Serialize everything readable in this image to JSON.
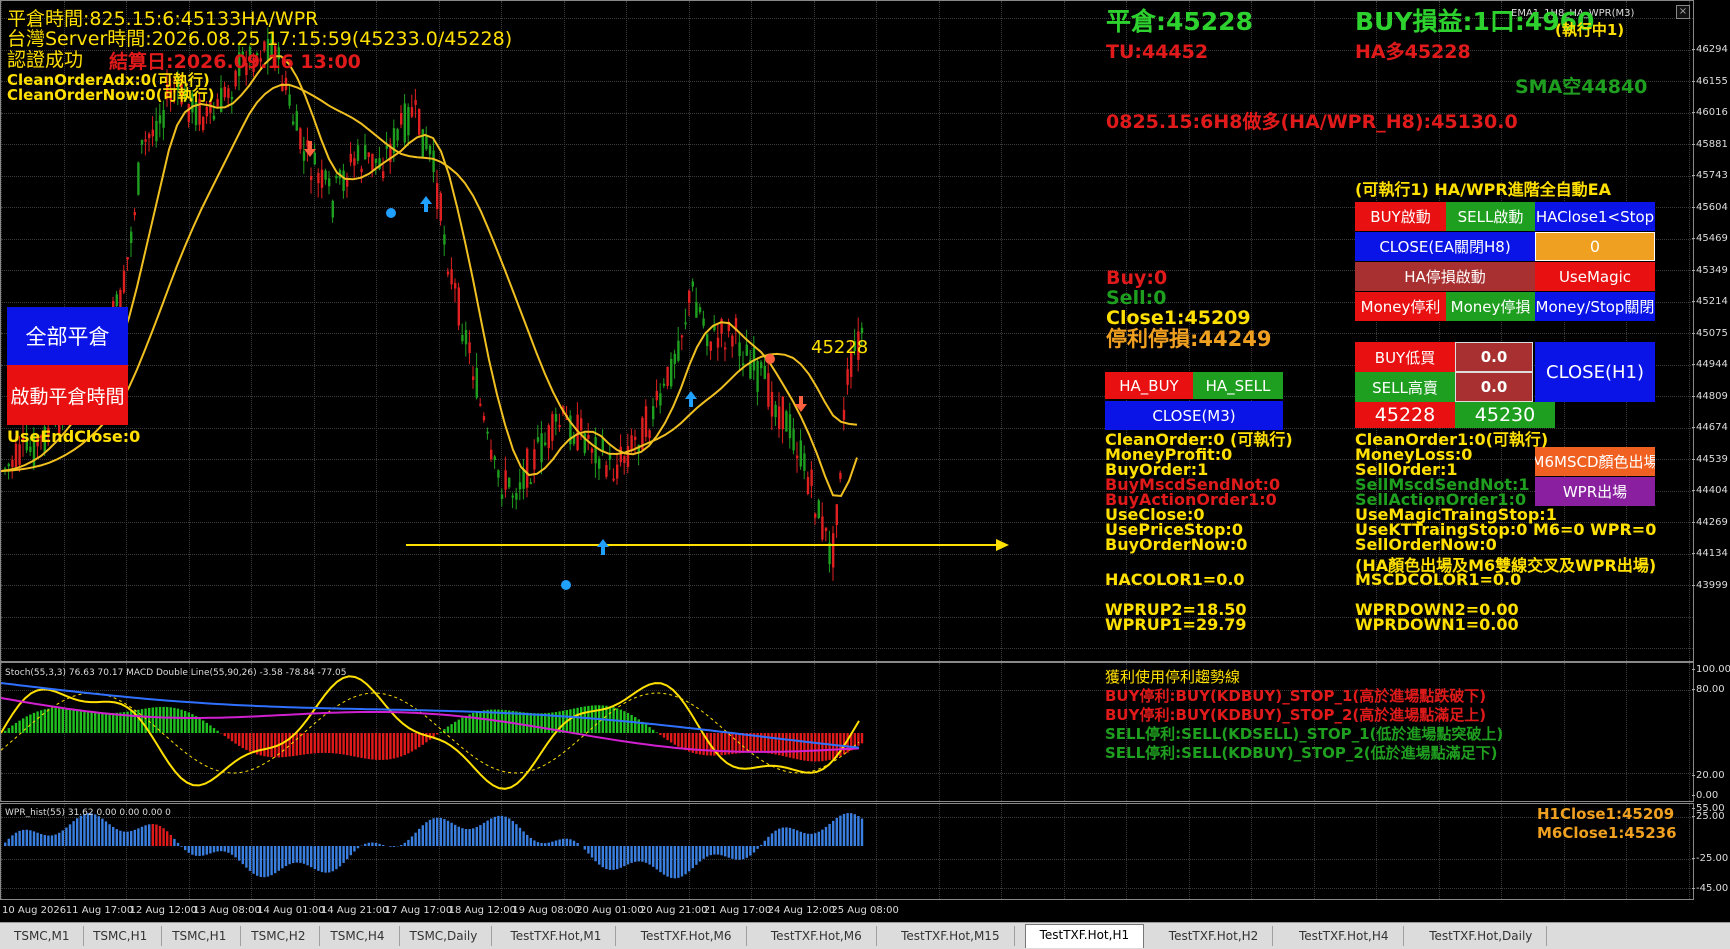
{
  "colors": {
    "bull": "#e02020",
    "bear": "#1f9f1f",
    "grid": "#3c3c3c",
    "ema": "#f0c020",
    "yellow": "#ffe000",
    "macd_line": "#d020d0",
    "signal_line": "#3070ff"
  },
  "info_left": {
    "line1": "平倉時間:825.15:6:45133HA/WPR",
    "line2": "台灣Server時間:2026.08.25 17:15:59(45233.0/45228)",
    "line3": "認證成功",
    "expiry": "結算日:2026.09.16 13:00",
    "clean_adx": "CleanOrderAdx:0(可執行)",
    "clean_now": "CleanOrderNow:0(可執行)"
  },
  "left_buttons": {
    "close_all": "全部平倉",
    "start_time": "啟動平倉時間",
    "use_end_close": "UseEndClose:0"
  },
  "chart_label_price": "45228",
  "header_stats": {
    "close_price": "平倉:45228",
    "pnl": "BUY損益:1口:4960",
    "running": "(執行中1)",
    "tu": "TU:44452",
    "ha_long": "HA多45228",
    "sma": "SMA空44840",
    "signal": "0825.15:6H8做多(HA/WPR_H8):45130.0",
    "top_right_label": "EMA1_1H8_HA_WPR(M3)"
  },
  "mid_stats": {
    "buy": "Buy:0",
    "sell": "Sell:0",
    "close1": "Close1:45209",
    "stop": "停利停損:44249"
  },
  "mid_buttons": {
    "ha_buy": "HA_BUY",
    "ha_sell": "HA_SELL",
    "close_m3": "CLOSE(M3)"
  },
  "mid_params": [
    {
      "text": "CleanOrder:0 (可執行)",
      "color": "#ffe000"
    },
    {
      "text": "MoneyProfit:0",
      "color": "#ffe000"
    },
    {
      "text": "BuyOrder:1",
      "color": "#ffe000"
    },
    {
      "text": "BuyMscdSendNot:0",
      "color": "#e01a1a"
    },
    {
      "text": "BuyActionOrder1:0",
      "color": "#e01a1a"
    },
    {
      "text": "UseClose:0",
      "color": "#ffe000"
    },
    {
      "text": "UsePriceStop:0",
      "color": "#ffe000"
    },
    {
      "text": "BuyOrderNow:0",
      "color": "#ffe000"
    }
  ],
  "mid_params2": {
    "hacolor": "HACOLOR1=0.0",
    "wprup2": "WPRUP2=18.50",
    "wprup1": "WPRUP1=29.79"
  },
  "ea_panel": {
    "title": "(可執行1)  HA/WPR進階全自動EA",
    "buy_start": "BUY啟動",
    "sell_start": "SELL啟動",
    "haclose": "HAClose1<Stop",
    "close_ea": "CLOSE(EA關閉H8)",
    "zero": "0",
    "ha_stop": "HA停損啟動",
    "use_magic": "UseMagic",
    "money_profit": "Money停利",
    "money_stop": "Money停損",
    "money_close": "Money/Stop關閉",
    "buy_low": "BUY低買",
    "buy_low_val": "0.0",
    "sell_high": "SELL高賣",
    "sell_high_val": "0.0",
    "close_h1": "CLOSE(H1)",
    "bid": "45228",
    "ask": "45230",
    "m6mscd": "M6MSCD顏色出場",
    "wpr_exit": "WPR出場"
  },
  "right_params": [
    {
      "text": "CleanOrder1:0(可執行)",
      "color": "#ffe000"
    },
    {
      "text": "MoneyLoss:0",
      "color": "#ffe000"
    },
    {
      "text": "SellOrder:1",
      "color": "#ffe000"
    },
    {
      "text": "SellMscdSendNot:1",
      "color": "#1f9f1f"
    },
    {
      "text": "SellActionOrder1:0",
      "color": "#1f9f1f"
    },
    {
      "text": "UseMagicTraingStop:1",
      "color": "#ffe000"
    },
    {
      "text": "UseKTTraingStop:0  M6=0  WPR=0",
      "color": "#ffe000"
    },
    {
      "text": "SellOrderNow:0",
      "color": "#ffe000"
    }
  ],
  "right_params2": {
    "exit_note": "(HA顏色出場及M6雙線交叉及WPR出場)",
    "mscdcolor": "MSCDCOLOR1=0.0",
    "wprdown2": "WPRDOWN2=0.00",
    "wprdown1": "WPRDOWN1=0.00"
  },
  "price_scale": [
    "46294",
    "46155",
    "46016",
    "45881",
    "45743",
    "45604",
    "45469",
    "45349",
    "45214",
    "45075",
    "44944",
    "44809",
    "44674",
    "44539",
    "44404",
    "44269",
    "44134",
    "43999"
  ],
  "stoch": {
    "label": "Stoch(55,3,3) 76.63 70.17 MACD Double Line(55,90,26) -3.58 -78.84 -77.05",
    "title": "獲利使用停利趨勢線",
    "lines": [
      {
        "text": "BUY停利:BUY(KDBUY)_STOP_1(高於進場點跌破下)",
        "color": "#e01a1a"
      },
      {
        "text": "BUY停利:BUY(KDBUY)_STOP_2(高於進場點滿足上)",
        "color": "#e01a1a"
      },
      {
        "text": "SELL停利:SELL(KDSELL)_STOP_1(低於進場點突破上)",
        "color": "#1f9f1f"
      },
      {
        "text": "SELL停利:SELL(KDBUY)_STOP_2(低於進場點滿足下)",
        "color": "#1f9f1f"
      }
    ],
    "scale": [
      "100.00",
      "80.00",
      "20.00",
      "0.00"
    ]
  },
  "wpr": {
    "label": "WPR_hist(55) 31.62 0.00 0.00 0.00 0",
    "h1close": "H1Close1:45209",
    "m6close": "M6Close1:45236",
    "scale": [
      "55.00",
      "25.00",
      "-25.00",
      "-45.00"
    ]
  },
  "time_axis": [
    "10 Aug 2026",
    "11 Aug 17:00",
    "12 Aug 12:00",
    "13 Aug 08:00",
    "14 Aug 01:00",
    "14 Aug 21:00",
    "17 Aug 17:00",
    "18 Aug 12:00",
    "19 Aug 08:00",
    "20 Aug 01:00",
    "20 Aug 21:00",
    "21 Aug 17:00",
    "24 Aug 12:00",
    "25 Aug 08:00"
  ],
  "tabs": [
    "TSMC,M1",
    "TSMC,H1",
    "TSMC,H1",
    "TSMC,H2",
    "TSMC,H4",
    "TSMC,Daily",
    "TestTXF.Hot,M1",
    "TestTXF.Hot,M6",
    "TestTXF.Hot,M6",
    "TestTXF.Hot,M15",
    "TestTXF.Hot,H1",
    "TestTXF.Hot,H2",
    "TestTXF.Hot,H4",
    "TestTXF.Hot,Daily"
  ],
  "active_tab": 10
}
